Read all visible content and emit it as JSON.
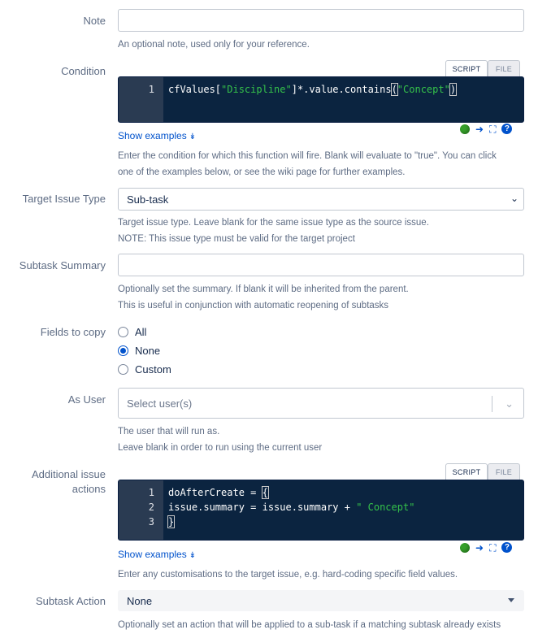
{
  "note": {
    "label": "Note",
    "value": "",
    "help": "An optional note, used only for your reference."
  },
  "condition": {
    "label": "Condition",
    "tabs": [
      "SCRIPT",
      "FILE"
    ],
    "lines": [
      {
        "num": "1",
        "pre": "cfValues[",
        "s1": "\"Discipline\"",
        "mid": "]*.value.contains",
        "open": "(",
        "s2": "\"Concept\"",
        "close": ")"
      }
    ],
    "show_examples": "Show examples",
    "help1": "Enter the condition for which this function will fire. Blank will evaluate to \"true\". You can click",
    "help2": "one of the examples below, or see the wiki page for further examples."
  },
  "target_issue_type": {
    "label": "Target Issue Type",
    "value": "Sub-task",
    "help1": "Target issue type. Leave blank for the same issue type as the source issue.",
    "help2": "NOTE: This issue type must be valid for the target project"
  },
  "subtask_summary": {
    "label": "Subtask Summary",
    "value": "",
    "help1": "Optionally set the summary. If blank it will be inherited from the parent.",
    "help2": "This is useful in conjunction with automatic reopening of subtasks"
  },
  "fields_to_copy": {
    "label": "Fields to copy",
    "options": [
      "All",
      "None",
      "Custom"
    ],
    "selected": "None"
  },
  "as_user": {
    "label": "As User",
    "placeholder": "Select user(s)",
    "help1": "The user that will run as.",
    "help2": "Leave blank in order to run using the current user"
  },
  "additional_actions": {
    "label_line1": "Additional issue",
    "label_line2": "actions",
    "tabs": [
      "SCRIPT",
      "FILE"
    ],
    "line1": {
      "num": "1",
      "text": "doAfterCreate = ",
      "brace": "{"
    },
    "line2": {
      "num": "2",
      "text": "issue.summary = issue.summary + ",
      "str": "\" Concept\""
    },
    "line3": {
      "num": "3",
      "brace": "}"
    },
    "show_examples": "Show examples",
    "help": "Enter any customisations to the target issue, e.g. hard-coding specific field values."
  },
  "subtask_action": {
    "label": "Subtask Action",
    "value": "None",
    "help": "Optionally set an action that will be applied to a sub-task if a matching subtask already exists"
  },
  "icons": {
    "status": "status-ok-icon",
    "expand": "expand-icon",
    "fullscreen": "fullscreen-icon",
    "help": "help-icon",
    "chevron": "chevron-down-icon"
  },
  "colors": {
    "editor_bg": "#0b2440",
    "gutter_bg": "#2a3b52",
    "string": "#35c24a",
    "link": "#0052cc",
    "label": "#5e6c84"
  }
}
